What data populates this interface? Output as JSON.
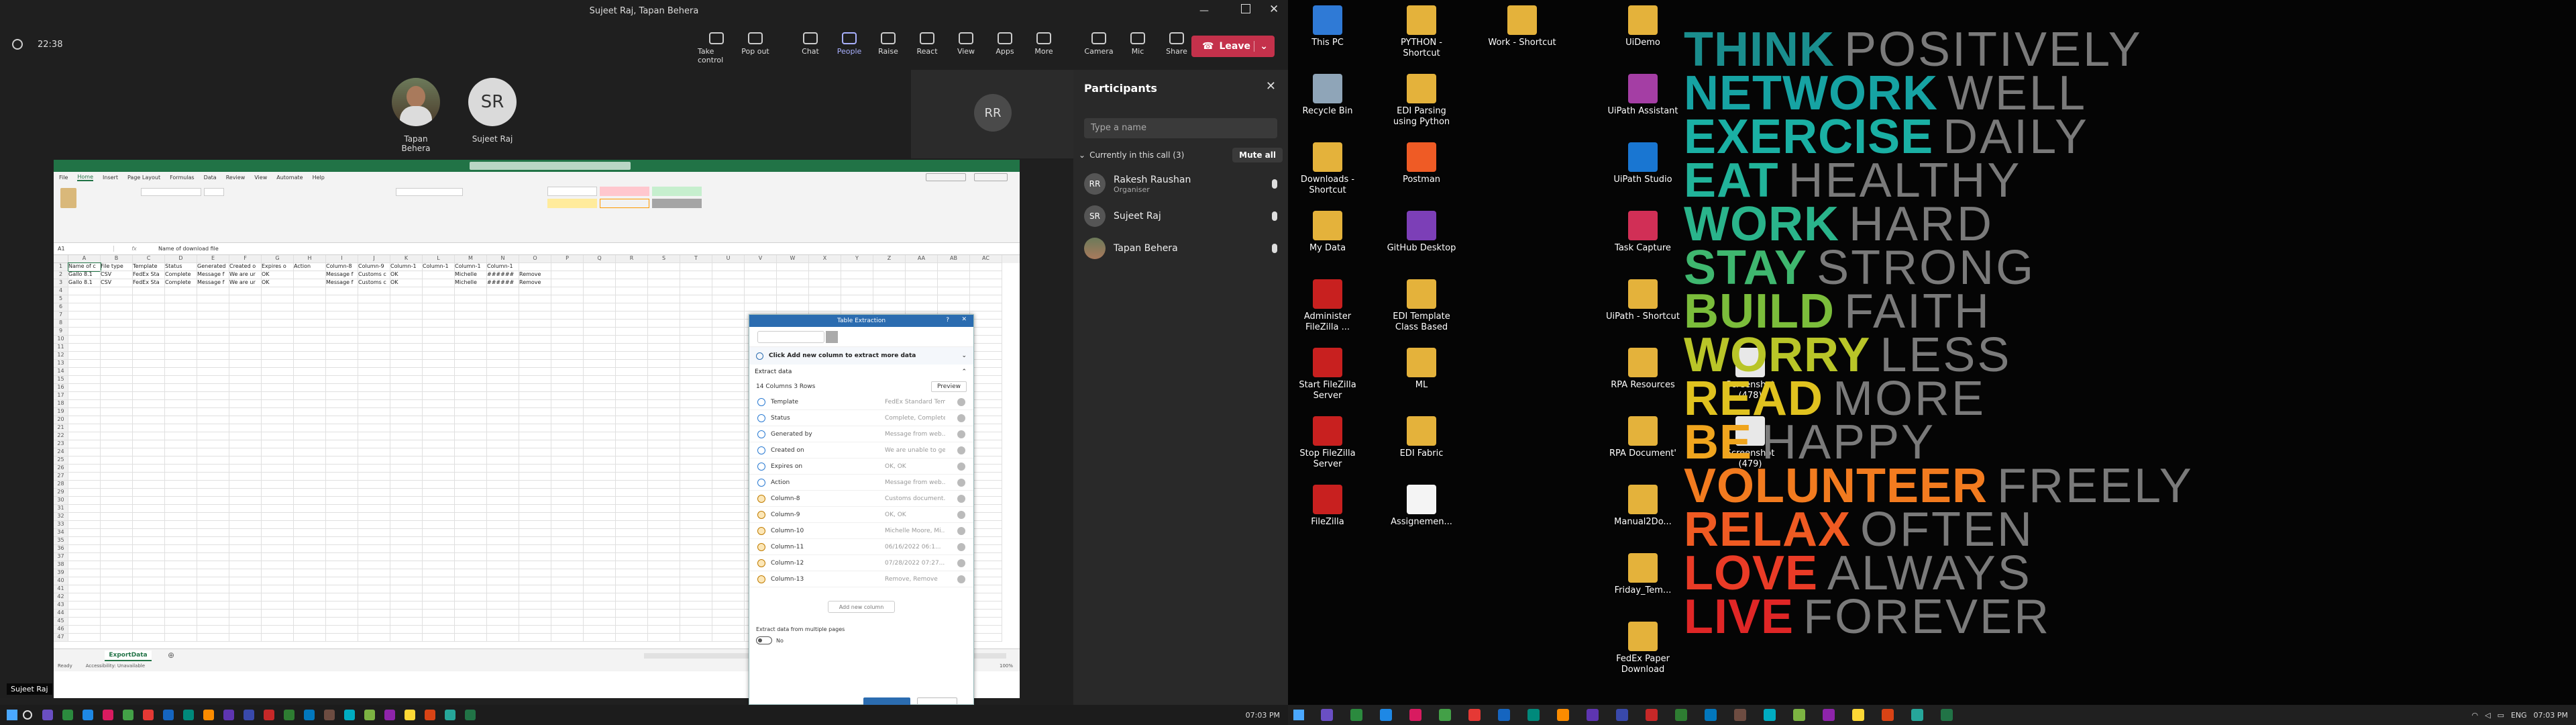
{
  "teams": {
    "window_title": "Sujeet Raj, Tapan Behera",
    "time": "22:38",
    "controls": [
      "Take control",
      "Pop out",
      "Chat",
      "People",
      "Raise",
      "React",
      "View",
      "Apps",
      "More",
      "Camera",
      "Mic",
      "Share"
    ],
    "leave_label": "Leave",
    "stage": [
      {
        "initials": "",
        "name": "Tapan Behera"
      },
      {
        "initials": "SR",
        "name": "Sujeet Raj"
      }
    ],
    "self_initials": "RR",
    "shared_label": "Sujeet Raj"
  },
  "participants": {
    "title": "Participants",
    "search_placeholder": "Type a name",
    "section_label": "Currently in this call (3)",
    "mute_all": "Mute all",
    "people": [
      {
        "initials": "RR",
        "name": "Rakesh Raushan",
        "role": "Organiser"
      },
      {
        "initials": "SR",
        "name": "Sujeet Raj",
        "role": ""
      },
      {
        "initials": "",
        "name": "Tapan Behera",
        "role": ""
      }
    ]
  },
  "excel": {
    "title": "ExportData.csv",
    "tabs": [
      "File",
      "Home",
      "Insert",
      "Page Layout",
      "Formulas",
      "Data",
      "Review",
      "View",
      "Automate",
      "Help"
    ],
    "name_box": "A1",
    "formula": "Name of download file",
    "columns": [
      "A",
      "B",
      "C",
      "D",
      "E",
      "F",
      "G",
      "H",
      "I",
      "J",
      "K",
      "L",
      "M",
      "N",
      "O",
      "P",
      "Q",
      "R",
      "S",
      "T",
      "U",
      "V",
      "W",
      "X",
      "Y",
      "Z",
      "AA",
      "AB",
      "AC"
    ],
    "rows": [
      [
        "Name of c",
        "File type",
        "Template",
        "Status",
        "Generated",
        "Created o",
        "Expires o",
        "Action",
        "Column-8",
        "Column-9",
        "Column-1",
        "Column-1",
        "Column-1",
        "Column-1"
      ],
      [
        "Gallo 8.1",
        "CSV",
        "FedEx Sta",
        "Complete",
        "Message f",
        "We are ur",
        "OK",
        "",
        "Message f",
        "Customs c",
        "OK",
        "",
        "Michelle",
        "######",
        "Remove"
      ],
      [
        "Gallo 8.1",
        "CSV",
        "FedEx Sta",
        "Complete",
        "Message f",
        "We are ur",
        "OK",
        "",
        "Message f",
        "Customs c",
        "OK",
        "",
        "Michelle",
        "######",
        "Remove"
      ]
    ],
    "sheet_tab": "ExportData",
    "status_left": "Ready",
    "status_acc": "Accessibility: Unavailable",
    "zoom": "100%"
  },
  "extraction": {
    "title": "Table Extraction",
    "hint": "Click Add new column to extract more data",
    "section": "Extract data",
    "summary": "14 Columns  3 Rows",
    "preview": "Preview",
    "columns": [
      {
        "name": "Template",
        "value": "FedEx Standard Tem..."
      },
      {
        "name": "Status",
        "value": "Complete, Complete..."
      },
      {
        "name": "Generated by",
        "value": "Message from web..."
      },
      {
        "name": "Created on",
        "value": "We are unable to ge..."
      },
      {
        "name": "Expires on",
        "value": "OK, OK"
      },
      {
        "name": "Action",
        "value": "Message from web..."
      },
      {
        "name": "Column-8",
        "value": "Customs document..."
      },
      {
        "name": "Column-9",
        "value": "OK, OK"
      },
      {
        "name": "Column-10",
        "value": "Michelle Moore, Mi..."
      },
      {
        "name": "Column-11",
        "value": "06/16/2022 06:1..."
      },
      {
        "name": "Column-12",
        "value": "07/28/2022 07:27..."
      },
      {
        "name": "Column-13",
        "value": "Remove, Remove"
      }
    ],
    "add_column": "Add new column",
    "multi_page": "Extract data from multiple pages",
    "toggle": "No"
  },
  "taskbar_left": {
    "time": "07:03 PM"
  },
  "desktop": {
    "icons": [
      {
        "label": "This PC",
        "color": "#2f7ad6"
      },
      {
        "label": "Recycle Bin",
        "color": "#8fa5b8"
      },
      {
        "label": "Downloads - Shortcut",
        "color": "#e4b23b"
      },
      {
        "label": "My Data",
        "color": "#e4b23b"
      },
      {
        "label": "Administer FileZilla ...",
        "color": "#c8201f"
      },
      {
        "label": "Start FileZilla Server",
        "color": "#c8201f"
      },
      {
        "label": "Stop FileZilla Server",
        "color": "#c8201f"
      },
      {
        "label": "FileZilla",
        "color": "#c8201f"
      },
      {
        "label": "PYTHON - Shortcut",
        "color": "#e4b23b"
      },
      {
        "label": "EDI Parsing using Python",
        "color": "#e4b23b"
      },
      {
        "label": "Postman",
        "color": "#ef5b25"
      },
      {
        "label": "GitHub Desktop",
        "color": "#7c3fb7"
      },
      {
        "label": "EDI Template Class Based",
        "color": "#e4b23b"
      },
      {
        "label": "ML",
        "color": "#e4b23b"
      },
      {
        "label": "EDI Fabric",
        "color": "#e4b23b"
      },
      {
        "label": "Assignemen...",
        "color": "#f4f4f4"
      },
      {
        "label": "Work - Shortcut",
        "color": "#e4b23b"
      },
      {
        "label": "UiDemo",
        "color": "#e4b23b"
      },
      {
        "label": "UiPath Assistant",
        "color": "#a43ea4"
      },
      {
        "label": "UiPath Studio",
        "color": "#1976d2"
      },
      {
        "label": "Task Capture",
        "color": "#d12f56"
      },
      {
        "label": "UiPath - Shortcut",
        "color": "#e4b23b"
      },
      {
        "label": "RPA Resources",
        "color": "#e4b23b"
      },
      {
        "label": "RPA Document'",
        "color": "#e4b23b"
      },
      {
        "label": "Manual2Do...",
        "color": "#e4b23b"
      },
      {
        "label": "Friday_Tem...",
        "color": "#e4b23b"
      },
      {
        "label": "FedEx Paper Download",
        "color": "#e4b23b"
      },
      {
        "label": "Screenshot (478)",
        "color": "#e8e8e8"
      },
      {
        "label": "Screenshot (479)",
        "color": "#e8e8e8"
      }
    ],
    "motto": [
      {
        "w1": "THINK",
        "w2": "POSITIVELY",
        "color": "#1a8e8e"
      },
      {
        "w1": "NETWORK",
        "w2": "WELL",
        "color": "#16a3a3"
      },
      {
        "w1": "EXERCISE",
        "w2": "DAILY",
        "color": "#1ab0a4"
      },
      {
        "w1": "EAT",
        "w2": "HEALTHY",
        "color": "#21b39a"
      },
      {
        "w1": "WORK",
        "w2": "HARD",
        "color": "#2ab48b"
      },
      {
        "w1": "STAY",
        "w2": "STRONG",
        "color": "#3fb76f"
      },
      {
        "w1": "BUILD",
        "w2": "FAITH",
        "color": "#7bbd3b"
      },
      {
        "w1": "WORRY",
        "w2": "LESS",
        "color": "#b9c528"
      },
      {
        "w1": "READ",
        "w2": "MORE",
        "color": "#e0c21f"
      },
      {
        "w1": "BE",
        "w2": "HAPPY",
        "color": "#f0a51e"
      },
      {
        "w1": "VOLUNTEER",
        "w2": "FREELY",
        "color": "#f27b1f"
      },
      {
        "w1": "RELAX",
        "w2": "OFTEN",
        "color": "#ef5a22"
      },
      {
        "w1": "LOVE",
        "w2": "ALWAYS",
        "color": "#ea3b26"
      },
      {
        "w1": "LIVE",
        "w2": "FOREVER",
        "color": "#e02626"
      }
    ]
  },
  "taskbar_right": {
    "lang": "ENG",
    "time": "07:03 PM"
  }
}
